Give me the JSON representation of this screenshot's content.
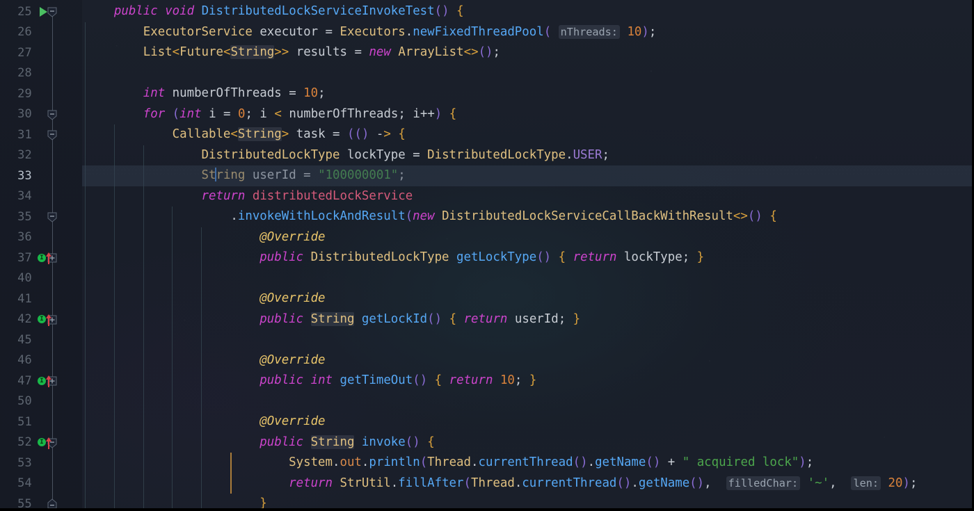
{
  "editor": {
    "theme_name": "dark-night-blue",
    "font_size_px": 17,
    "colors": {
      "background": "#1a1f2a",
      "gutter_background": "#161a24",
      "current_line": "#384256",
      "caret": "#4a90e2",
      "keyword": "#cc44cc",
      "type": "#e0c080",
      "method": "#56a8f5",
      "number": "#d9823b",
      "string": "#4ca64c",
      "annotation": "#e8c46a",
      "identifier": "#c8cdd4",
      "param_hint": "#9aa4b0",
      "run_marker": "#4bbf62",
      "override_badge": "#19b849",
      "override_arrow": "#d9434a",
      "indent_guide_active": "#c48e3e"
    },
    "current_line_number": 33,
    "caret_line": 33,
    "caret_column": 16
  },
  "lines": [
    {
      "num": "25",
      "indent": 0,
      "gutter": {
        "run": true,
        "fold": "expanded"
      },
      "text": "    public void DistributedLockServiceInvokeTest() {"
    },
    {
      "num": "26",
      "indent": 1,
      "gutter": {},
      "text": "        ExecutorService executor = Executors.newFixedThreadPool( nThreads: 10);"
    },
    {
      "num": "27",
      "indent": 1,
      "gutter": {},
      "text": "        List<Future<String>> results = new ArrayList<>();"
    },
    {
      "num": "28",
      "indent": 1,
      "gutter": {},
      "text": ""
    },
    {
      "num": "29",
      "indent": 1,
      "gutter": {},
      "text": "        int numberOfThreads = 10;"
    },
    {
      "num": "30",
      "indent": 1,
      "gutter": {
        "fold": "expanded"
      },
      "text": "        for (int i = 0; i < numberOfThreads; i++) {"
    },
    {
      "num": "31",
      "indent": 2,
      "gutter": {
        "fold": "expanded"
      },
      "text": "            Callable<String> task = (() -> {"
    },
    {
      "num": "32",
      "indent": 3,
      "gutter": {},
      "text": "                DistributedLockType lockType = DistributedLockType.USER;"
    },
    {
      "num": "33",
      "indent": 3,
      "gutter": {},
      "current": true,
      "text": "                String userId = \"100000001\";"
    },
    {
      "num": "34",
      "indent": 3,
      "gutter": {},
      "text": "                return distributedLockService"
    },
    {
      "num": "35",
      "indent": 4,
      "gutter": {
        "fold": "expanded"
      },
      "text": "                    .invokeWithLockAndResult(new DistributedLockServiceCallBackWithResult<>() {"
    },
    {
      "num": "36",
      "indent": 5,
      "gutter": {},
      "text": "                        @Override"
    },
    {
      "num": "37",
      "indent": 5,
      "gutter": {
        "override": true,
        "fold": "collapsed"
      },
      "text": "                        public DistributedLockType getLockType() { return lockType; }"
    },
    {
      "num": "40",
      "indent": 5,
      "gutter": {},
      "text": ""
    },
    {
      "num": "41",
      "indent": 5,
      "gutter": {},
      "text": "                        @Override"
    },
    {
      "num": "42",
      "indent": 5,
      "gutter": {
        "override": true,
        "fold": "collapsed"
      },
      "text": "                        public String getLockId() { return userId; }"
    },
    {
      "num": "45",
      "indent": 5,
      "gutter": {},
      "text": ""
    },
    {
      "num": "46",
      "indent": 5,
      "gutter": {},
      "text": "                        @Override"
    },
    {
      "num": "47",
      "indent": 5,
      "gutter": {
        "override": true,
        "fold": "collapsed"
      },
      "text": "                        public int getTimeOut() { return 10; }"
    },
    {
      "num": "50",
      "indent": 5,
      "gutter": {},
      "text": ""
    },
    {
      "num": "51",
      "indent": 5,
      "gutter": {},
      "text": "                        @Override"
    },
    {
      "num": "52",
      "indent": 5,
      "gutter": {
        "override": true,
        "fold": "expanded"
      },
      "text": "                        public String invoke() {"
    },
    {
      "num": "53",
      "indent": 6,
      "gutter": {},
      "text": "                            System.out.println(Thread.currentThread().getName() + \" acquired lock\");"
    },
    {
      "num": "54",
      "indent": 6,
      "gutter": {},
      "text": "                            return StrUtil.fillAfter(Thread.currentThread().getName(),  filledChar: '~',  len: 20);"
    },
    {
      "num": "55",
      "indent": 5,
      "gutter": {
        "fold": "expanded-end"
      },
      "text": "                        }"
    }
  ],
  "parameter_hints": [
    {
      "line": "26",
      "label": "nThreads:",
      "value": "10"
    },
    {
      "line": "54",
      "label": "filledChar:",
      "value": "'~'"
    },
    {
      "line": "54",
      "label": "len:",
      "value": "20"
    }
  ],
  "gutter_icons": {
    "run": "run-triangle-icon",
    "override_badge": "override-implementation-badge-icon",
    "override_arrow": "override-arrow-icon",
    "fold_expanded": "fold-collapse-icon",
    "fold_collapsed": "fold-expand-icon"
  }
}
